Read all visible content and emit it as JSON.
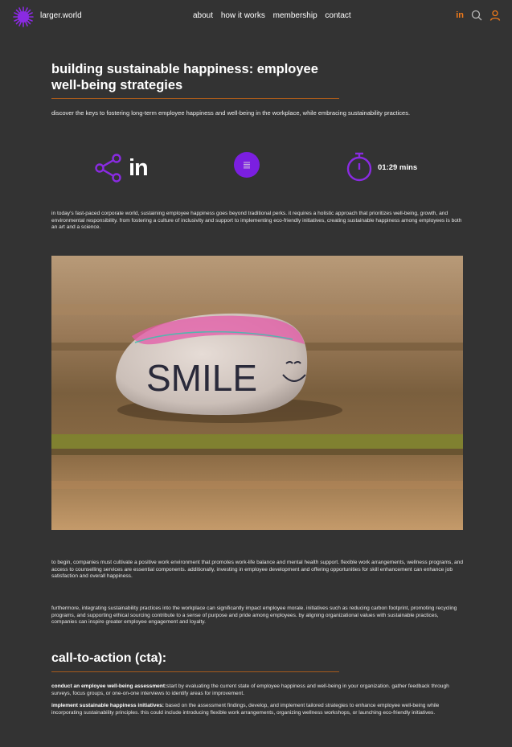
{
  "nav": {
    "brand": "larger.world",
    "links": [
      "about",
      "how it works",
      "membership",
      "contact"
    ],
    "linkedin_glyph": "in",
    "accent": "#f07a1a"
  },
  "article": {
    "title": "building sustainable happiness: employee well-being strategies",
    "subtitle": "discover the keys to fostering long-term employee happiness and well-being in the workplace, while embracing sustainability practices.",
    "share_linkedin": "in",
    "read_time": "01:29 mins",
    "intro": "in today's fast-paced corporate world, sustaining employee happiness goes beyond traditional perks. it requires a holistic approach that prioritizes well-being, growth, and environmental responsibility. from fostering a culture of inclusivity and support to implementing eco-friendly initiatives, creating sustainable happiness among employees is both an art and a science.",
    "image_text": "SMILE",
    "p1": "to begin, companies must cultivate a positive work environment that promotes work-life balance and mental health support. flexible work arrangements, wellness programs, and access to counselling services are essential components. additionally, investing in employee development and offering opportunities for skill enhancement can enhance job satisfaction and overall happiness.",
    "p2": "furthermore, integrating sustainability practices into the workplace can significantly impact employee morale. initiatives such as reducing carbon footprint, promoting recycling programs, and supporting ethical sourcing contribute to a sense of purpose and pride among employees. by aligning organizational values with sustainable practices, companies can inspire greater employee engagement and loyalty.",
    "cta_heading": "call-to-action (cta):",
    "cta": [
      {
        "label": "conduct an employee well-being assessment:",
        "text": "start by evaluating the current state of employee happiness and well-being in your organization. gather feedback through surveys, focus groups, or one-on-one interviews to identify areas for improvement."
      },
      {
        "label": "implement sustainable happiness initiatives:",
        "text": " based on the assessment findings, develop, and implement tailored strategies to enhance employee well-being while incorporating sustainability principles. this could include introducing flexible work arrangements, organizing wellness workshops, or launching eco-friendly initiatives."
      }
    ]
  },
  "colors": {
    "background": "#333333",
    "purple": "#7b1fe0",
    "orange_rule": "#a65a1c"
  }
}
